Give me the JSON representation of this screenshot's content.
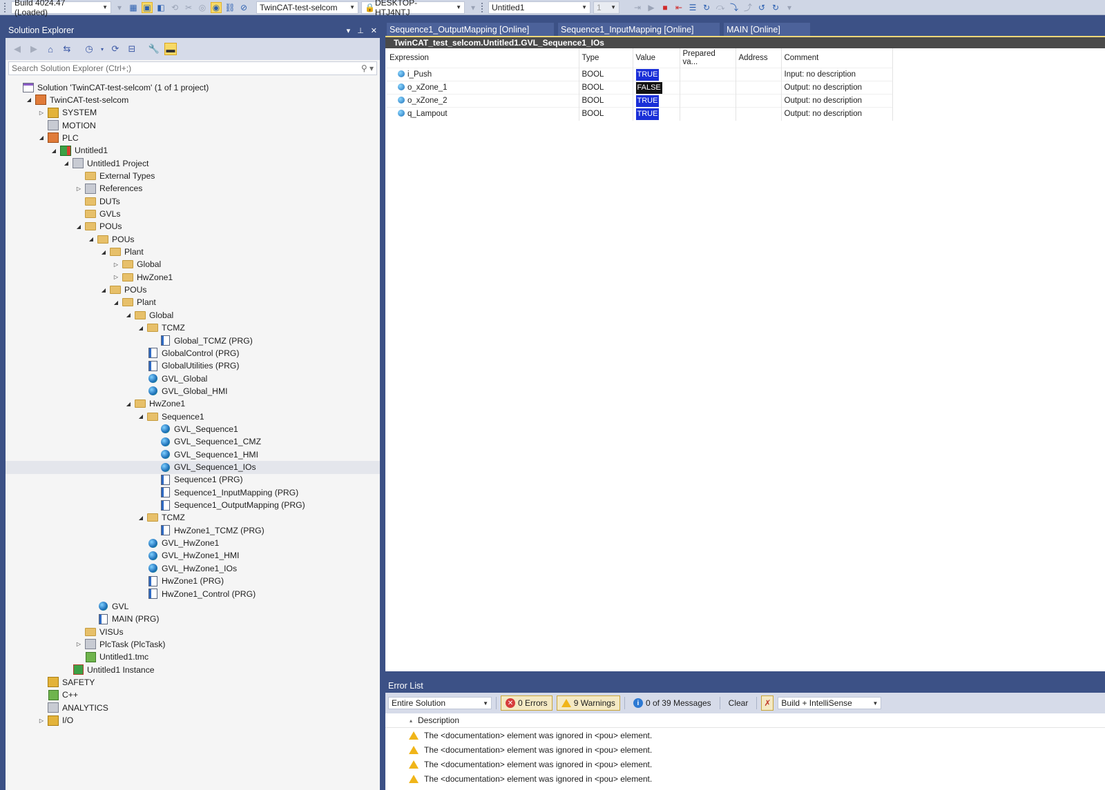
{
  "toolbar": {
    "build_config": "Build 4024.47 (Loaded)",
    "solution_combo": "TwinCAT-test-selcom",
    "target_combo": "DESKTOP-HTJ4NTJ",
    "plc_combo": "Untitled1",
    "instance_combo": "1"
  },
  "solution_explorer": {
    "title": "Solution Explorer",
    "search_placeholder": "Search Solution Explorer (Ctrl+;)",
    "tree": [
      {
        "label": "Solution 'TwinCAT-test-selcom' (1 of 1 project)",
        "icon": "solution-icon",
        "depth": 0,
        "expander": ""
      },
      {
        "label": "TwinCAT-test-selcom",
        "icon": "project-icon",
        "depth": 1,
        "expander": "open"
      },
      {
        "label": "SYSTEM",
        "icon": "system-icon",
        "depth": 2,
        "expander": "closed"
      },
      {
        "label": "MOTION",
        "icon": "motion-icon",
        "depth": 2,
        "expander": ""
      },
      {
        "label": "PLC",
        "icon": "plc-icon",
        "depth": 2,
        "expander": "open"
      },
      {
        "label": "Untitled1",
        "icon": "plc-project-icon",
        "depth": 3,
        "expander": "open"
      },
      {
        "label": "Untitled1 Project",
        "icon": "project-file-icon",
        "depth": 4,
        "expander": "open"
      },
      {
        "label": "External Types",
        "icon": "folder-icon",
        "depth": 5,
        "expander": ""
      },
      {
        "label": "References",
        "icon": "references-icon",
        "depth": 5,
        "expander": "closed"
      },
      {
        "label": "DUTs",
        "icon": "folder-icon",
        "depth": 5,
        "expander": ""
      },
      {
        "label": "GVLs",
        "icon": "folder-icon",
        "depth": 5,
        "expander": ""
      },
      {
        "label": "POUs",
        "icon": "folder-icon",
        "depth": 5,
        "expander": "open"
      },
      {
        "label": "POUs",
        "icon": "folder-icon",
        "depth": 6,
        "expander": "open"
      },
      {
        "label": "Plant",
        "icon": "folder-icon",
        "depth": 7,
        "expander": "open"
      },
      {
        "label": "Global",
        "icon": "folder-icon",
        "depth": 8,
        "expander": "closed"
      },
      {
        "label": "HwZone1",
        "icon": "folder-icon",
        "depth": 8,
        "expander": "closed"
      },
      {
        "label": "POUs",
        "icon": "folder-icon",
        "depth": 7,
        "expander": "open"
      },
      {
        "label": "Plant",
        "icon": "folder-icon",
        "depth": 8,
        "expander": "open"
      },
      {
        "label": "Global",
        "icon": "folder-icon",
        "depth": 9,
        "expander": "open"
      },
      {
        "label": "TCMZ",
        "icon": "folder-icon",
        "depth": 10,
        "expander": "open"
      },
      {
        "label": "Global_TCMZ (PRG)",
        "icon": "prg-icon",
        "depth": 11,
        "expander": ""
      },
      {
        "label": "GlobalControl (PRG)",
        "icon": "prg-icon",
        "depth": 10,
        "expander": ""
      },
      {
        "label": "GlobalUtilities (PRG)",
        "icon": "prg-icon",
        "depth": 10,
        "expander": ""
      },
      {
        "label": "GVL_Global",
        "icon": "gvl-icon",
        "depth": 10,
        "expander": ""
      },
      {
        "label": "GVL_Global_HMI",
        "icon": "gvl-icon",
        "depth": 10,
        "expander": ""
      },
      {
        "label": "HwZone1",
        "icon": "folder-icon",
        "depth": 9,
        "expander": "open"
      },
      {
        "label": "Sequence1",
        "icon": "folder-icon",
        "depth": 10,
        "expander": "open"
      },
      {
        "label": "GVL_Sequence1",
        "icon": "gvl-icon",
        "depth": 11,
        "expander": ""
      },
      {
        "label": "GVL_Sequence1_CMZ",
        "icon": "gvl-icon",
        "depth": 11,
        "expander": ""
      },
      {
        "label": "GVL_Sequence1_HMI",
        "icon": "gvl-icon",
        "depth": 11,
        "expander": ""
      },
      {
        "label": "GVL_Sequence1_IOs",
        "icon": "gvl-icon",
        "depth": 11,
        "expander": "",
        "selected": true
      },
      {
        "label": "Sequence1 (PRG)",
        "icon": "prg-icon",
        "depth": 11,
        "expander": ""
      },
      {
        "label": "Sequence1_InputMapping (PRG)",
        "icon": "prg-icon",
        "depth": 11,
        "expander": ""
      },
      {
        "label": "Sequence1_OutputMapping (PRG)",
        "icon": "prg-icon",
        "depth": 11,
        "expander": ""
      },
      {
        "label": "TCMZ",
        "icon": "folder-icon",
        "depth": 10,
        "expander": "open"
      },
      {
        "label": "HwZone1_TCMZ (PRG)",
        "icon": "prg-icon",
        "depth": 11,
        "expander": ""
      },
      {
        "label": "GVL_HwZone1",
        "icon": "gvl-icon",
        "depth": 10,
        "expander": ""
      },
      {
        "label": "GVL_HwZone1_HMI",
        "icon": "gvl-icon",
        "depth": 10,
        "expander": ""
      },
      {
        "label": "GVL_HwZone1_IOs",
        "icon": "gvl-icon",
        "depth": 10,
        "expander": ""
      },
      {
        "label": "HwZone1 (PRG)",
        "icon": "prg-icon",
        "depth": 10,
        "expander": ""
      },
      {
        "label": "HwZone1_Control (PRG)",
        "icon": "prg-icon",
        "depth": 10,
        "expander": ""
      },
      {
        "label": "GVL",
        "icon": "gvl-icon",
        "depth": 6,
        "expander": ""
      },
      {
        "label": "MAIN (PRG)",
        "icon": "prg-icon",
        "depth": 6,
        "expander": ""
      },
      {
        "label": "VISUs",
        "icon": "folder-icon",
        "depth": 5,
        "expander": ""
      },
      {
        "label": "PlcTask (PlcTask)",
        "icon": "task-icon",
        "depth": 5,
        "expander": "closed"
      },
      {
        "label": "Untitled1.tmc",
        "icon": "tmc-icon",
        "depth": 5,
        "expander": ""
      },
      {
        "label": "Untitled1 Instance",
        "icon": "instance-icon",
        "depth": 4,
        "expander": ""
      },
      {
        "label": "SAFETY",
        "icon": "safety-icon",
        "depth": 2,
        "expander": ""
      },
      {
        "label": "C++",
        "icon": "cpp-icon",
        "depth": 2,
        "expander": ""
      },
      {
        "label": "ANALYTICS",
        "icon": "analytics-icon",
        "depth": 2,
        "expander": ""
      },
      {
        "label": "I/O",
        "icon": "io-icon",
        "depth": 2,
        "expander": "closed"
      }
    ]
  },
  "document": {
    "tabs": [
      {
        "label": "Sequence1_OutputMapping [Online]"
      },
      {
        "label": "Sequence1_InputMapping [Online]"
      },
      {
        "label": "MAIN [Online]"
      }
    ],
    "gvl_title": "TwinCAT_test_selcom.Untitled1.GVL_Sequence1_IOs",
    "columns": [
      "Expression",
      "Type",
      "Value",
      "Prepared va...",
      "Address",
      "Comment"
    ],
    "rows": [
      {
        "expression": "i_Push",
        "type": "BOOL",
        "value": "TRUE",
        "prepared": "",
        "address": "",
        "comment": "Input: no description"
      },
      {
        "expression": "o_xZone_1",
        "type": "BOOL",
        "value": "FALSE",
        "prepared": "",
        "address": "",
        "comment": "Output: no description"
      },
      {
        "expression": "o_xZone_2",
        "type": "BOOL",
        "value": "TRUE",
        "prepared": "",
        "address": "",
        "comment": "Output: no description"
      },
      {
        "expression": "q_Lampout",
        "type": "BOOL",
        "value": "TRUE",
        "prepared": "",
        "address": "",
        "comment": "Output: no description"
      }
    ]
  },
  "error_list": {
    "title": "Error List",
    "scope": "Entire Solution",
    "errors_label": "0 Errors",
    "warnings_label": "9 Warnings",
    "messages_label": "0 of 39 Messages",
    "clear_label": "Clear",
    "filter_label": "Build + IntelliSense",
    "description_header": "Description",
    "rows": [
      "The <documentation> element was ignored in <pou> element.",
      "The <documentation> element was ignored in <pou> element.",
      "The <documentation> element was ignored in <pou> element.",
      "The <documentation> element was ignored in <pou> element."
    ]
  },
  "colors": {
    "accent": "#3c5186",
    "value_true": "#1a2fd8",
    "value_false": "#111111",
    "warning": "#f0b519",
    "error": "#d63c3c"
  }
}
